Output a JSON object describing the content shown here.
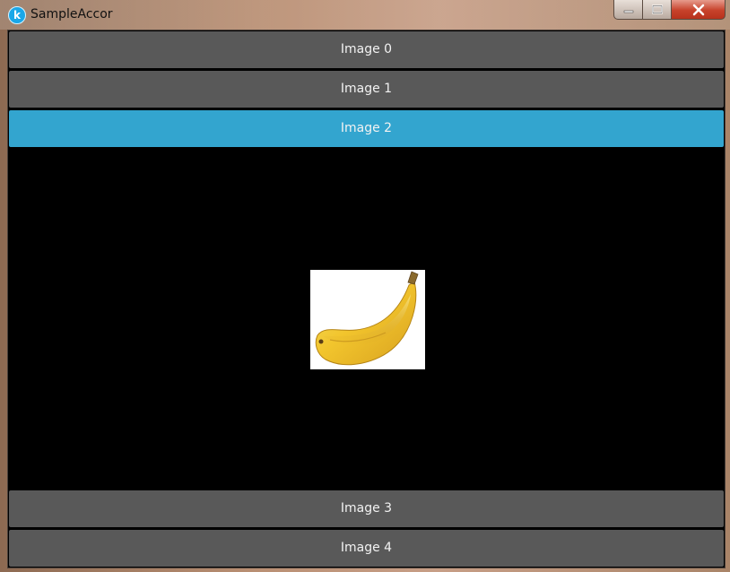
{
  "window": {
    "title": "SampleAccor",
    "icon": "kivy-app-icon",
    "controls": {
      "minimize_icon": "minimize-icon",
      "maximize_icon": "maximize-icon",
      "close_icon": "close-icon"
    }
  },
  "accordion": {
    "items": [
      {
        "label": "Image 0",
        "expanded": false
      },
      {
        "label": "Image 1",
        "expanded": false
      },
      {
        "label": "Image 2",
        "expanded": true,
        "content": "banana-image"
      },
      {
        "label": "Image 3",
        "expanded": false
      },
      {
        "label": "Image 4",
        "expanded": false
      }
    ],
    "colors": {
      "header": "#595959",
      "active_header": "#33a5cf",
      "content_background": "#000000",
      "header_text": "#f2f2f2"
    }
  }
}
